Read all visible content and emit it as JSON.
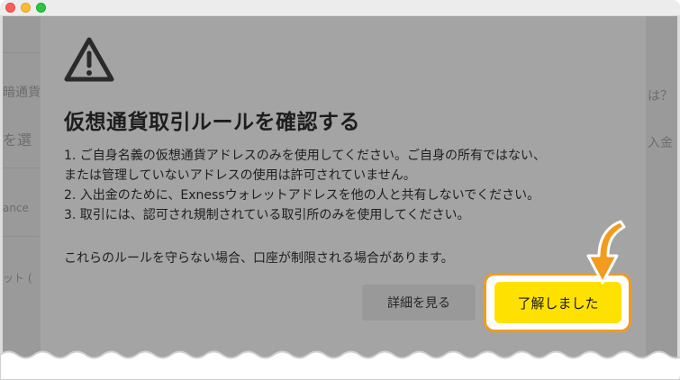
{
  "background": {
    "left_fragments": [
      "暗通貨",
      "を選",
      "ance",
      "ット ("
    ],
    "right_fragments": [
      "は？",
      "入金"
    ]
  },
  "modal": {
    "icon": "warning-triangle-icon",
    "title": "仮想通貨取引ルールを確認する",
    "rules": [
      "1. ご自身名義の仮想通貨アドレスのみを使用してください。ご自身の所有ではない、",
      "または管理していないアドレスの使用は許可されていません。",
      "2. 入出金のために、Exnessウォレットアドレスを他の人と共有しないでください。",
      "3. 取引には、認可され規制されている取引所のみを使用してください。"
    ],
    "note": "これらのルールを守らない場合、口座が制限される場合があります。",
    "details_button": "詳細を見る",
    "confirm_button": "了解しました"
  },
  "colors": {
    "accent": "#ffe100",
    "highlight": "#f29b1c",
    "overlay": "#9a9a9a"
  }
}
